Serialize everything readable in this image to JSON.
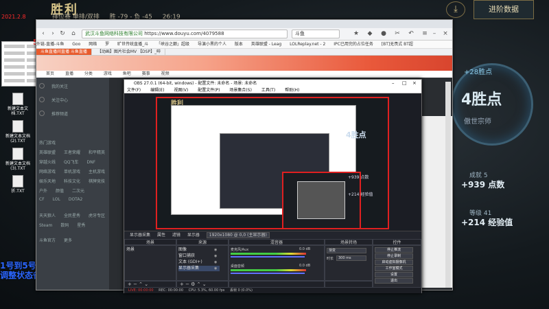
{
  "game": {
    "title": "胜利",
    "mode": "排位赛 单排/双排",
    "record": "胜 -79 - 负 -45",
    "time": "26:19",
    "advanced_button": "进阶数据",
    "points_gain": "+28胜点",
    "points_big": "4胜点",
    "rank_name": "傲世宗师",
    "growth_label": "成就 5",
    "growth_value": "+939 点数",
    "level_label": "等级 41",
    "level_value": "+214 经验值",
    "download_icon": "download-icon"
  },
  "desktop": {
    "icons": [
      "新建文本文档.TXT",
      "新建文本文档(2).TXT",
      "新建文本文档(3).TXT",
      "新建文本文档(2).TXT",
      "新建文本文档(3).TXT",
      "折.TXT"
    ],
    "badge": "574",
    "overlay_text_line1": "1号到5号只播个人",
    "overlay_text_line2": "调整状态备战新赛季",
    "overlay_top": "2021.2.8"
  },
  "browser": {
    "url_secure": "武汉斗鱼网络科技有限公司",
    "url": "https://www.douyu.com/4079588",
    "search_placeholder": "斗鱼",
    "bookmarks": [
      "外链-直播-斗鱼",
      "Goo",
      "网络",
      "罗",
      "旷世传统直播_斗",
      "「峡谷之巅」超级",
      "导演小黑的个人",
      "版本",
      "英雄联盟 - Leag",
      "LOLReplay.net - 2",
      "IPC已用完的占位任务",
      "[BT]无畏式 BT超"
    ],
    "tabs": [
      "斗鱼直播间直播 斗鱼直播",
      "【动画】图片社会MV 【DSP】_哔"
    ],
    "site_nav": [
      "首页",
      "直播",
      "分类",
      "游戏",
      "鱼吧",
      "赛事",
      "视频",
      "鱼吧"
    ],
    "sidebar_rows": [
      [
        "我的关注"
      ],
      [
        "关注中心"
      ],
      [
        "推荐频道"
      ],
      [
        "热门游戏"
      ],
      [
        "英雄联盟",
        "王者荣耀",
        "和平精英"
      ],
      [
        "穿越火线",
        "QQ飞车",
        "DNF"
      ],
      [
        "网络游戏",
        "单机游戏",
        "主机游戏"
      ],
      [
        "娱乐天地",
        "科技文化",
        "棋牌竞技"
      ],
      [
        "户外",
        "颜值",
        "二次元"
      ],
      [
        "CF",
        "LOL",
        "DOTA2"
      ],
      [
        "天天狼人",
        "全民星秀",
        "虎牙专区"
      ],
      [
        "Steam",
        "数码",
        "星秀"
      ],
      [
        "斗鱼官方",
        "更多"
      ]
    ]
  },
  "obs": {
    "title": "OBS 27.0.1 (64-bit, windows) - 配置文件: 未命名 - 场景: 未命名",
    "menu": [
      "文件(F)",
      "编辑(E)",
      "视图(V)",
      "配置文件(P)",
      "场景集合(S)",
      "工具(T)",
      "帮助(H)"
    ],
    "scene_bar": {
      "label": "显示器采集",
      "props": "属性",
      "filter": "滤镜",
      "display_label": "显示器",
      "display_value": "1920x1080 @ 0,0 (主显示器)"
    },
    "panels": {
      "scenes": {
        "title": "场景",
        "items": [
          "场景"
        ]
      },
      "sources": {
        "title": "来源",
        "items": [
          "图像",
          "窗口捕获",
          "文本 (GDI+)",
          "显示器采集"
        ]
      },
      "mixer": {
        "title": "混音器",
        "rows": [
          {
            "name": "麦克风/Aux",
            "db": "0.0 dB"
          },
          {
            "name": "桌面音频",
            "db": "0.0 dB"
          }
        ]
      },
      "transitions": {
        "title": "场景转场",
        "type": "渐变",
        "duration_label": "时长",
        "duration": "300 ms"
      },
      "controls": {
        "title": "控件",
        "buttons": [
          "停止推流",
          "停止录制",
          "启动虚拟摄像机",
          "工作室模式",
          "设置",
          "退出"
        ]
      }
    },
    "status": {
      "live": "LIVE: 00:00:00",
      "rec": "REC: 00:00:00",
      "cpu": "CPU: 5.3%, 60.00 fps",
      "dropped": "丢帧 0 (0.0%)"
    },
    "nested_title": "胜利",
    "nested_points": "4胜点",
    "nested_939": "+939 点数",
    "nested_214": "+214 经验值"
  }
}
